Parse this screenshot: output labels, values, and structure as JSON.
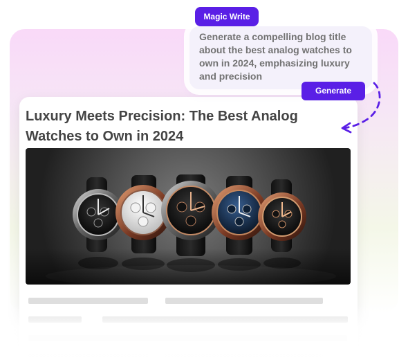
{
  "magic_write": {
    "label": "Magic Write"
  },
  "prompt": {
    "text": "Generate a compelling blog title about the best analog watches to own in 2024, emphasizing luxury and precision"
  },
  "generate_button": {
    "label": "Generate"
  },
  "article": {
    "title": "Luxury Meets Precision: The Best Analog Watches to Own in 2024"
  },
  "colors": {
    "accent": "#5A1FE6",
    "card_background": "#FFFFFF",
    "prompt_background": "#F4F1FB",
    "title_text": "#444444",
    "prompt_text": "#727272",
    "skeleton": "#DEDEDE"
  },
  "icons": {
    "arrow": "dashed-curved-arrow-icon"
  }
}
